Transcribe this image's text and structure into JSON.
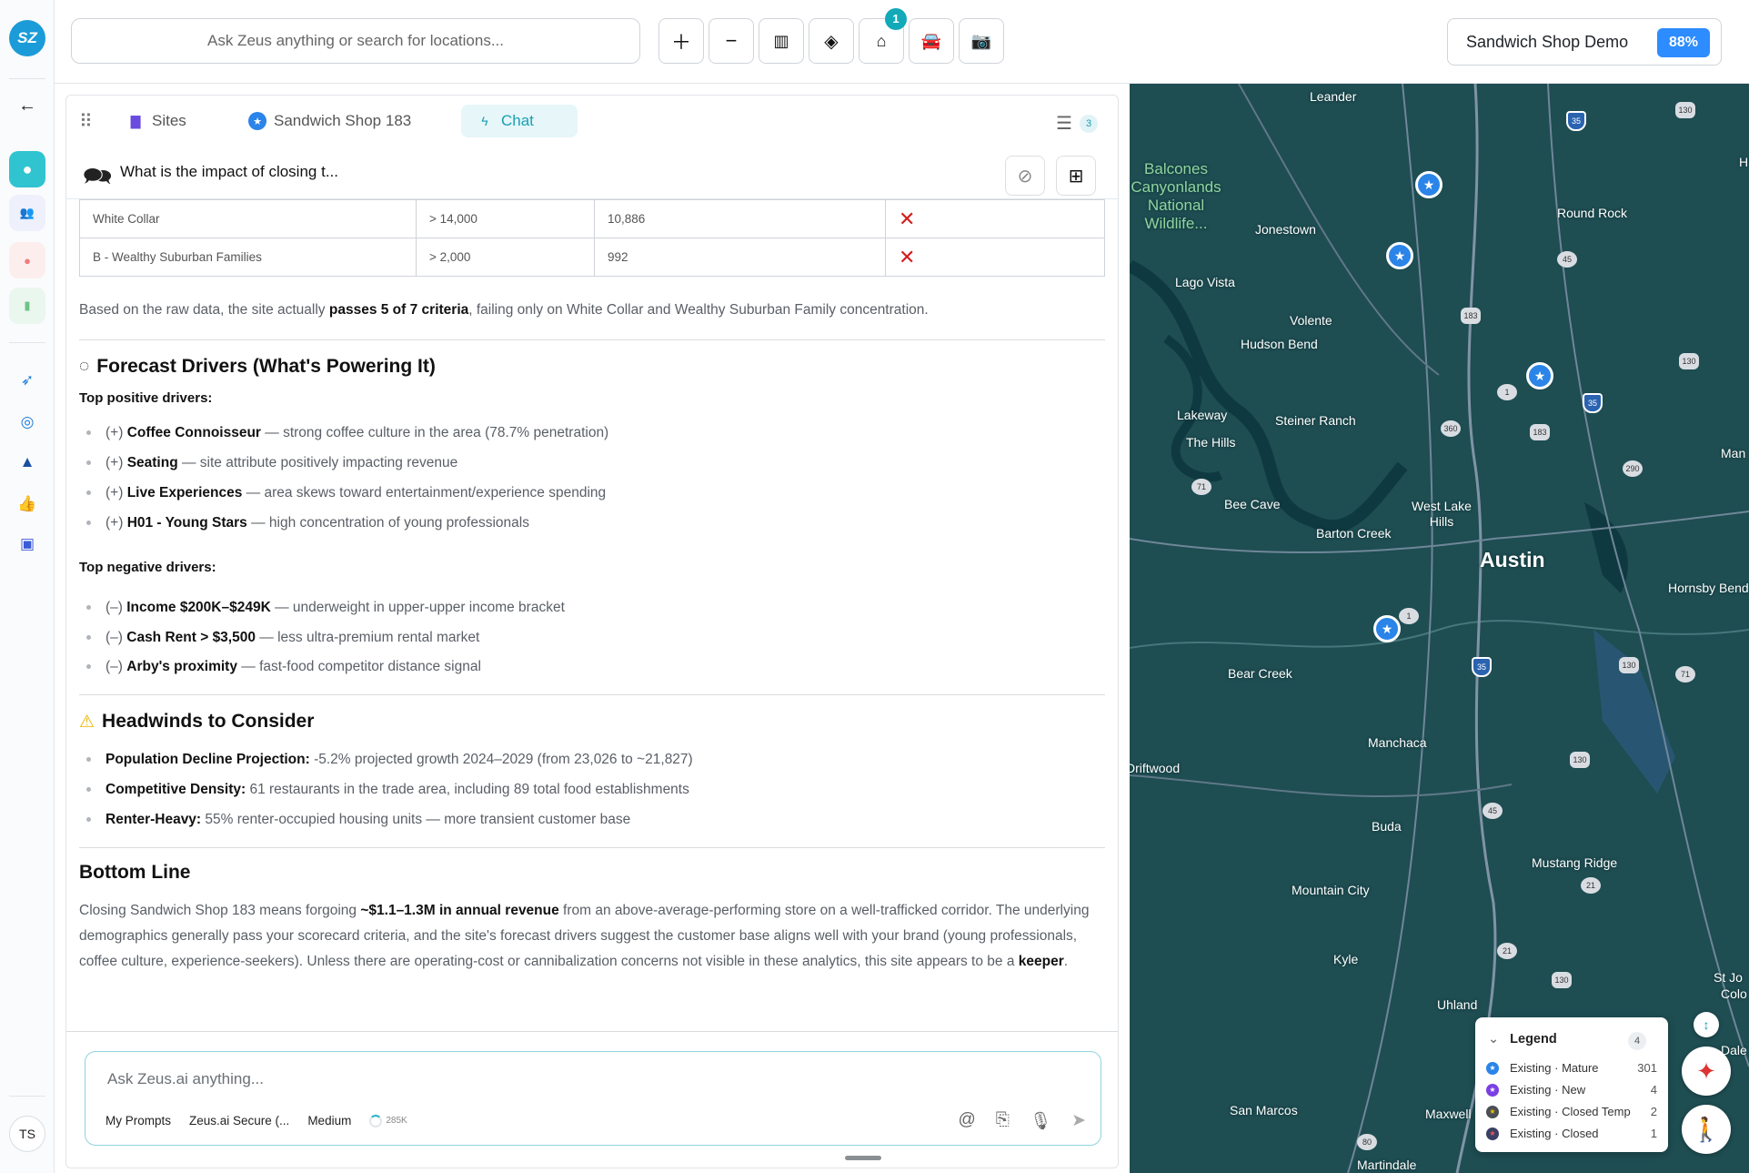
{
  "rail": {
    "logo": "SZ",
    "user_initials": "TS"
  },
  "topbar": {
    "search_placeholder": "Ask Zeus anything or search for locations...",
    "store_badge": "1",
    "project_name": "Sandwich Shop Demo",
    "project_pct": "88%"
  },
  "tabs": {
    "sites": "Sites",
    "shop": "Sandwich Shop 183",
    "chat": "Chat",
    "list_count": "3"
  },
  "thread": {
    "title": "What is the impact of closing t..."
  },
  "table": {
    "rows": [
      {
        "segment": "White Collar",
        "threshold": "> 14,000",
        "value": "10,886",
        "pass": false
      },
      {
        "segment": "B - Wealthy Suburban Families",
        "threshold": "> 2,000",
        "value": "992",
        "pass": false
      }
    ]
  },
  "summary": {
    "pre": "Based on the raw data, the site actually ",
    "bold": "passes 5 of 7 criteria",
    "post": ", failing only on White Collar and Wealthy Suburban Family concentration."
  },
  "drivers": {
    "heading": "Forecast Drivers (What's Powering It)",
    "positive_label": "Top positive drivers:",
    "positive": [
      {
        "sign": "(+) ",
        "name": "Coffee Connoisseur",
        "desc": " — strong coffee culture in the area (78.7% penetration)"
      },
      {
        "sign": "(+) ",
        "name": "Seating",
        "desc": " — site attribute positively impacting revenue"
      },
      {
        "sign": "(+) ",
        "name": "Live Experiences",
        "desc": " — area skews toward entertainment/experience spending"
      },
      {
        "sign": "(+) ",
        "name": "H01 - Young Stars",
        "desc": " — high concentration of young professionals"
      }
    ],
    "negative_label": "Top negative drivers:",
    "negative": [
      {
        "sign": "(–) ",
        "name": "Income $200K–$249K",
        "desc": " — underweight in upper-upper income bracket"
      },
      {
        "sign": "(–) ",
        "name": "Cash Rent > $3,500",
        "desc": " — less ultra-premium rental market"
      },
      {
        "sign": "(–) ",
        "name": "Arby's proximity",
        "desc": " — fast-food competitor distance signal"
      }
    ]
  },
  "headwinds": {
    "heading": "Headwinds to Consider",
    "items": [
      {
        "name": "Population Decline Projection:",
        "desc": " -5.2% projected growth 2024–2029 (from 23,026 to ~21,827)"
      },
      {
        "name": "Competitive Density:",
        "desc": " 61 restaurants in the trade area, including 89 total food establishments"
      },
      {
        "name": "Renter-Heavy:",
        "desc": " 55% renter-occupied housing units — more transient customer base"
      }
    ]
  },
  "bottom_line": {
    "heading": "Bottom Line",
    "p1": "Closing Sandwich Shop 183 means forgoing ",
    "b1": "~$1.1–1.3M in annual revenue",
    "p2": " from an above-average-performing store on a well-trafficked corridor. The underlying demographics generally pass your scorecard criteria, and the site's forecast drivers suggest the customer base aligns well with your brand (young professionals, coffee culture, experience-seekers). Unless there are operating-cost or cannibalization concerns not visible in these analytics, this site appears to be a ",
    "b2": "keeper",
    "p3": "."
  },
  "composer": {
    "placeholder": "Ask Zeus.ai anything...",
    "prompts": "My Prompts",
    "model": "Zeus.ai Secure (...",
    "effort": "Medium",
    "tokens": "285K"
  },
  "map": {
    "labels": {
      "leander": "Leander",
      "park": "Balcones Canyonlands National Wildlife...",
      "round_rock": "Round Rock",
      "jonestown": "Jonestown",
      "lago_vista": "Lago Vista",
      "volente": "Volente",
      "hudson_bend": "Hudson Bend",
      "lakeway": "Lakeway",
      "steiner_ranch": "Steiner Ranch",
      "the_hills": "The Hills",
      "bee_cave": "Bee Cave",
      "west_lake_hills": "West Lake Hills",
      "barton_creek": "Barton Creek",
      "austin": "Austin",
      "hornsby_bend": "Hornsby Bend",
      "bear_creek": "Bear Creek",
      "manchaca": "Manchaca",
      "driftwood": "Driftwood",
      "buda": "Buda",
      "mustang_ridge": "Mustang Ridge",
      "mountain_city": "Mountain City",
      "kyle": "Kyle",
      "uhland": "Uhland",
      "san_marcos": "San Marcos",
      "maxwell": "Maxwell",
      "martindale": "Martindale",
      "manor": "Man",
      "h_edge": "H",
      "st_john": "St Jo",
      "colo": "Colo",
      "dale": "Dale"
    },
    "shields": [
      "35",
      "130",
      "45",
      "183",
      "130",
      "35",
      "183",
      "360",
      "290",
      "71",
      "1",
      "1",
      "35",
      "130",
      "71",
      "130",
      "45",
      "21",
      "21",
      "130",
      "80"
    ]
  },
  "legend": {
    "title": "Legend",
    "count": "4",
    "rows": [
      {
        "label": "Existing · Mature",
        "count": "301",
        "color": "#2b84e8"
      },
      {
        "label": "Existing · New",
        "count": "4",
        "color": "#7b3fe4"
      },
      {
        "label": "Existing · Closed Temp",
        "count": "2",
        "color": "#4a4f55"
      },
      {
        "label": "Existing · Closed",
        "count": "1",
        "color": "#3b3f66"
      }
    ]
  }
}
